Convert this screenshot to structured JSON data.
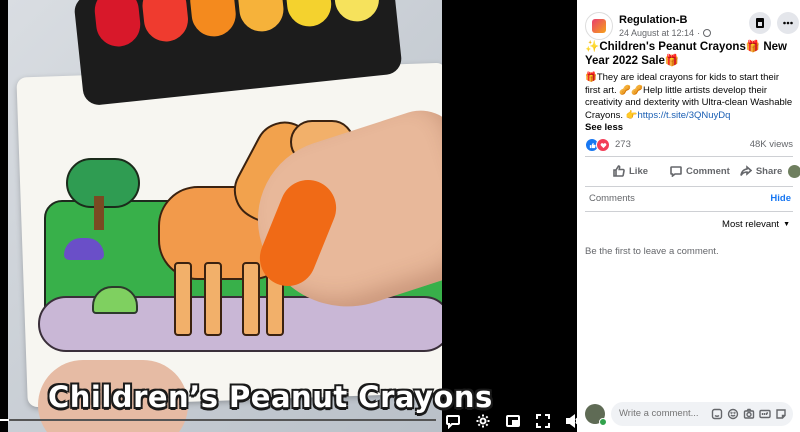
{
  "video": {
    "caption": "Children’s Peanut Crayons",
    "progress_fraction": 0.02
  },
  "post": {
    "page_name": "Regulation-B",
    "date": "24 August at 12:14",
    "separator": "·",
    "title": "✨Children's Peanut Crayons🎁 New Year 2022 Sale🎁",
    "body_text": "🎁They are ideal crayons for kids to start their first art. 🥜🥜Help little artists develop their creativity and dexterity with Ultra-clean Washable Crayons. 👉",
    "link": "https://t.site/3QNuyDq",
    "see_less": "See less",
    "reaction_count": "273",
    "views": "48K views"
  },
  "actions": {
    "like": "Like",
    "comment": "Comment",
    "share": "Share"
  },
  "comments": {
    "label": "Comments",
    "hide": "Hide",
    "sort": "Most relevant",
    "empty": "Be the first to leave a comment.",
    "placeholder": "Write a comment..."
  },
  "colors": {
    "accent": "#1877f2",
    "like": "#1877f2",
    "love": "#f33e58",
    "online": "#31a24c"
  },
  "icons": {
    "controls": [
      "captions-icon",
      "settings-icon",
      "picture-in-picture-icon",
      "fullscreen-icon",
      "volume-icon"
    ],
    "composer": [
      "sticker-icon",
      "emoji-icon",
      "camera-icon",
      "gif-icon",
      "avatar-sticker-icon"
    ]
  }
}
